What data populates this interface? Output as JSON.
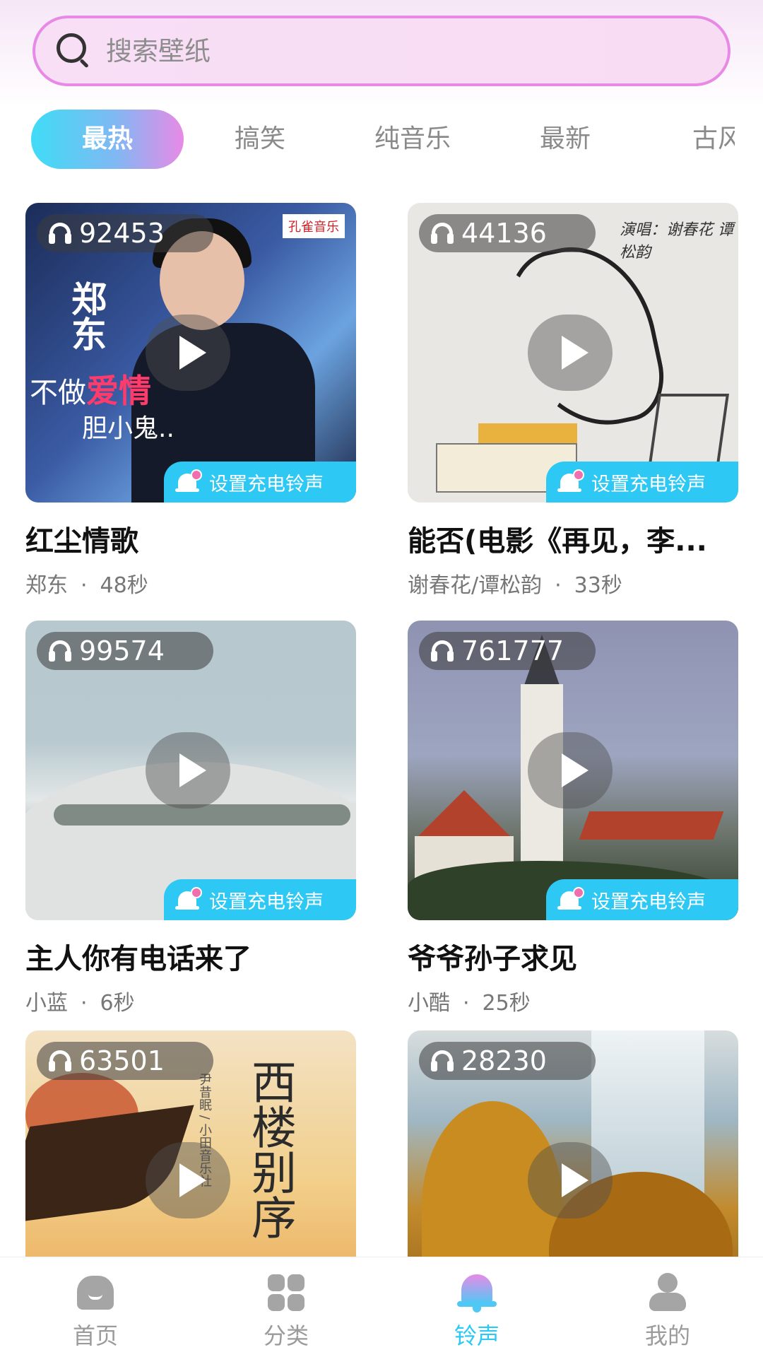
{
  "search": {
    "placeholder": "搜索壁纸",
    "icon": "search-icon"
  },
  "tabs": [
    {
      "label": "最热",
      "active": true
    },
    {
      "label": "搞笑",
      "active": false
    },
    {
      "label": "纯音乐",
      "active": false
    },
    {
      "label": "最新",
      "active": false
    },
    {
      "label": "古风",
      "active": false
    }
  ],
  "cards": [
    {
      "plays": "92453",
      "action": "设置充电铃声",
      "title": "红尘情歌",
      "artist": "郑东",
      "separator": "·",
      "duration": "48秒",
      "cover_text": {
        "vertical": "郑东",
        "line1_a": "不做",
        "line1_b": "爱情",
        "line2": "胆小鬼..",
        "logo": "孔雀音乐"
      }
    },
    {
      "plays": "44136",
      "action": "设置充电铃声",
      "title": "能否(电影《再见，李...",
      "artist": "谢春花/谭松韵",
      "separator": "·",
      "duration": "33秒",
      "cover_text": {
        "note": "演唱：谢春花 谭松韵"
      }
    },
    {
      "plays": "99574",
      "action": "设置充电铃声",
      "title": "主人你有电话来了",
      "artist": "小蓝",
      "separator": "·",
      "duration": "6秒"
    },
    {
      "plays": "761777",
      "action": "设置充电铃声",
      "title": "爷爷孙子求见",
      "artist": "小酷",
      "separator": "·",
      "duration": "25秒"
    },
    {
      "plays": "63501",
      "title": "",
      "artist": "",
      "duration": "",
      "cover_text": {
        "calligraphy": "西楼别序",
        "credits": "尹昔眠 / 小田音乐社"
      }
    },
    {
      "plays": "28230",
      "title": "",
      "artist": "",
      "duration": ""
    }
  ],
  "nav": [
    {
      "label": "首页",
      "icon": "home-icon",
      "active": false
    },
    {
      "label": "分类",
      "icon": "grid-icon",
      "active": false
    },
    {
      "label": "铃声",
      "icon": "bell-icon",
      "active": true
    },
    {
      "label": "我的",
      "icon": "person-icon",
      "active": false
    }
  ],
  "colors": {
    "accent": "#2ec8f5",
    "pink": "#e68ae6",
    "text_muted": "#8a8a8a"
  }
}
